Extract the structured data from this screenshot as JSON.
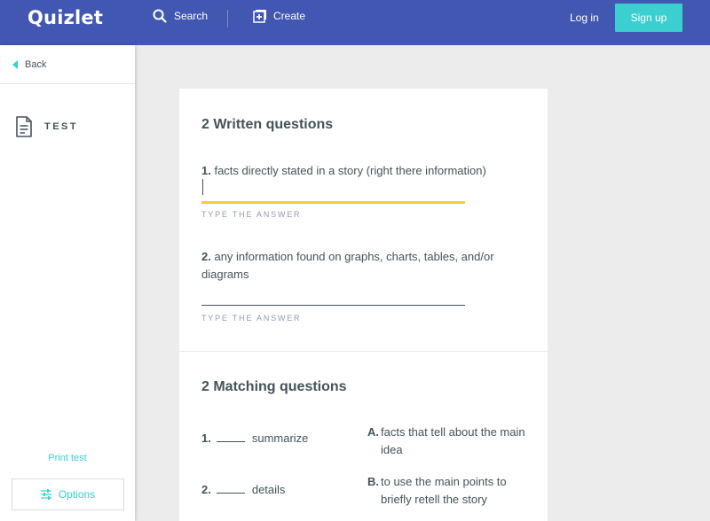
{
  "header": {
    "logo": "Quizlet",
    "search_label": "Search",
    "create_label": "Create",
    "login_label": "Log in",
    "signup_label": "Sign up"
  },
  "sidebar": {
    "back_label": "Back",
    "test_label": "TEST",
    "print_label": "Print test",
    "options_label": "Options"
  },
  "written": {
    "title": "2 Written questions",
    "questions": [
      {
        "number": "1.",
        "text": "facts directly stated in a story (right there information)",
        "hint": "TYPE THE ANSWER"
      },
      {
        "number": "2.",
        "text": "any information found on graphs, charts, tables, and/or diagrams",
        "hint": "TYPE THE ANSWER"
      }
    ]
  },
  "matching": {
    "title": "2 Matching questions",
    "questions": [
      {
        "number": "1.",
        "text": "summarize"
      },
      {
        "number": "2.",
        "text": "details"
      }
    ],
    "answers": [
      {
        "letter": "A.",
        "text": "facts that tell about the main idea"
      },
      {
        "letter": "B.",
        "text": "to use the main points to briefly retell the story"
      }
    ]
  },
  "colors": {
    "header_bg": "#4257b2",
    "accent": "#3ccfcf",
    "active_underline": "#ffcd1f"
  }
}
